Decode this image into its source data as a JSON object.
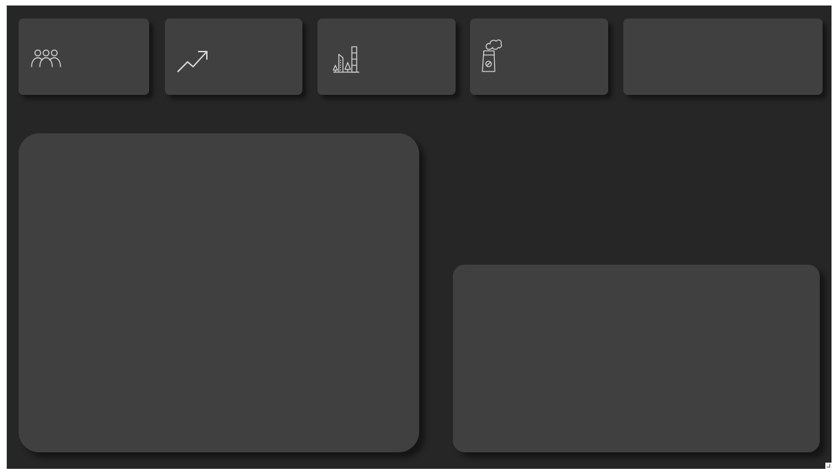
{
  "dashboard": {
    "background_color": "#262626",
    "card_color": "#404040",
    "icon_color": "#d9d9d9",
    "kpi_cards": [
      {
        "icon": "people-icon"
      },
      {
        "icon": "trend-up-icon"
      },
      {
        "icon": "city-buildings-icon"
      },
      {
        "icon": "factory-smoke-icon"
      },
      {
        "icon": ""
      }
    ],
    "panels": [
      "main-chart-panel",
      "secondary-panel"
    ]
  }
}
